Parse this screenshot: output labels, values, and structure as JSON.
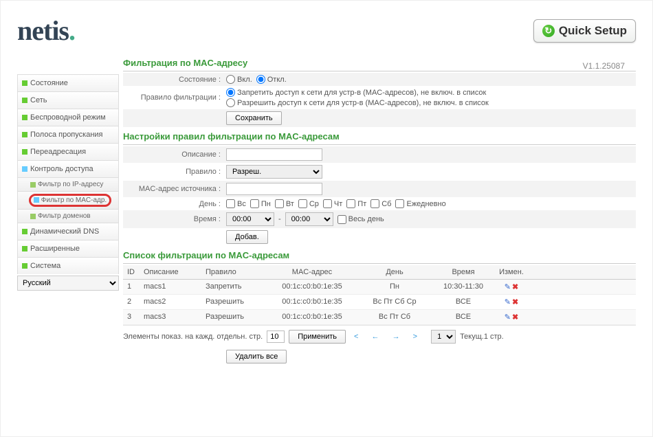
{
  "logo": "netis",
  "quick_setup": "Quick Setup",
  "version": "V1.1.25087",
  "lang": "Русский",
  "sidebar": {
    "items": [
      {
        "label": "Состояние"
      },
      {
        "label": "Сеть"
      },
      {
        "label": "Беспроводной режим"
      },
      {
        "label": "Полоса пропускания"
      },
      {
        "label": "Переадресация"
      },
      {
        "label": "Контроль доступа"
      },
      {
        "label": "Динамический DNS"
      },
      {
        "label": "Расширенные"
      },
      {
        "label": "Система"
      }
    ],
    "sub": {
      "ip": "Фильтр по IP-адресу",
      "mac": "Фильтр по MAC-адр.",
      "dom": "Фильтр доменов"
    }
  },
  "sec1": {
    "title": "Фильтрация по MAC-адресу",
    "state_lbl": "Состояние :",
    "on": "Вкл.",
    "off": "Откл.",
    "rule_lbl": "Правило фильтрации :",
    "deny": "Запретить доступ к сети для устр-в (MAC-адресов), не включ. в список",
    "allow": "Разрешить доступ к сети для устр-в (MAC-адресов), не включ. в список",
    "save": "Сохранить"
  },
  "sec2": {
    "title": "Настройки правил фильтрации по MAC-адресам",
    "desc_lbl": "Описание :",
    "rule_lbl": "Правило :",
    "rule_val": "Разреш.",
    "mac_lbl": "MAC-адрес источника :",
    "day_lbl": "День :",
    "days": {
      "sun": "Вс",
      "mon": "Пн",
      "tue": "Вт",
      "wed": "Ср",
      "thu": "Чт",
      "fri": "Пт",
      "sat": "Сб",
      "all": "Ежедневно"
    },
    "time_lbl": "Время :",
    "t1": "00:00",
    "tsep": "-",
    "t2": "00:00",
    "allday": "Весь день",
    "add": "Добав."
  },
  "sec3": {
    "title": "Список фильтрации по MAC-адресам",
    "head": {
      "id": "ID",
      "desc": "Описание",
      "rule": "Правило",
      "mac": "MAC-адрес",
      "day": "День",
      "time": "Время",
      "chg": "Измен."
    },
    "rows": [
      {
        "id": "1",
        "desc": "macs1",
        "rule": "Запретить",
        "mac": "00:1c:c0:b0:1e:35",
        "day": "Пн",
        "time": "10:30-11:30"
      },
      {
        "id": "2",
        "desc": "macs2",
        "rule": "Разрешить",
        "mac": "00:1c:c0:b0:1e:35",
        "day": "Вс Пт Сб Ср",
        "time": "ВСЕ"
      },
      {
        "id": "3",
        "desc": "macs3",
        "rule": "Разрешить",
        "mac": "00:1c:c0:b0:1e:35",
        "day": "Вс Пт Сб",
        "time": "ВСЕ"
      }
    ],
    "pager": {
      "lbl": "Элементы показ. на кажд. отдельн. стр.",
      "per": "10",
      "apply": "Применить",
      "pagesel": "1",
      "cur": "Текущ.1 стр.",
      "del": "Удалить все"
    }
  }
}
